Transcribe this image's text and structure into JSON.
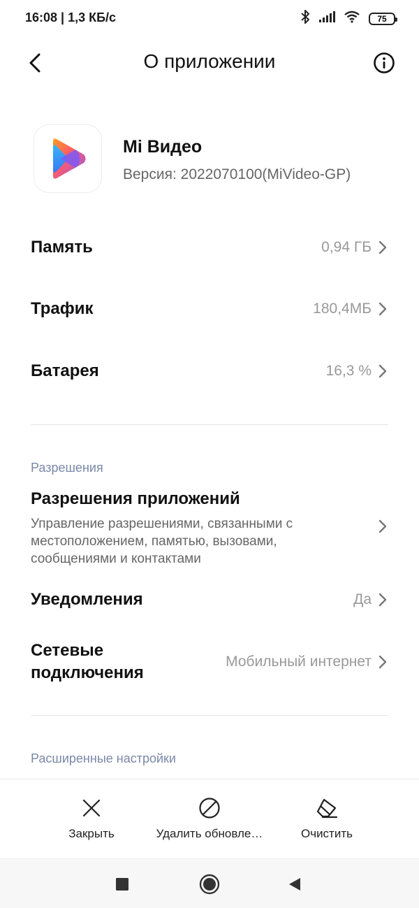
{
  "status_bar": {
    "time_speed": "16:08 | 1,3 КБ/с",
    "battery_level": "75"
  },
  "header": {
    "title": "О приложении"
  },
  "app": {
    "name": "Mi Видео",
    "version": "Версия: 2022070100(MiVideo-GP)"
  },
  "usage": [
    {
      "label": "Память",
      "value": "0,94 ГБ"
    },
    {
      "label": "Трафик",
      "value": "180,4МБ"
    },
    {
      "label": "Батарея",
      "value": "16,3 %"
    }
  ],
  "permissions": {
    "section_title": "Разрешения",
    "app_permissions_title": "Разрешения приложений",
    "app_permissions_desc": "Управление разрешениями, связанными с местоположением, памятью, вызовами, сообщениями и контактами",
    "notifications_label": "Уведомления",
    "notifications_value": "Да",
    "network_label_line1": "Сетевые",
    "network_label_line2": "подключения",
    "network_value": "Мобильный интернет"
  },
  "advanced": {
    "section_title": "Расширенные настройки"
  },
  "actions": [
    {
      "label": "Закрыть",
      "icon": "close-icon"
    },
    {
      "label": "Удалить обновле…",
      "icon": "block-icon"
    },
    {
      "label": "Очистить",
      "icon": "eraser-icon"
    }
  ],
  "colors": {
    "section_header": "#7a88a8",
    "value_text": "#999999"
  }
}
